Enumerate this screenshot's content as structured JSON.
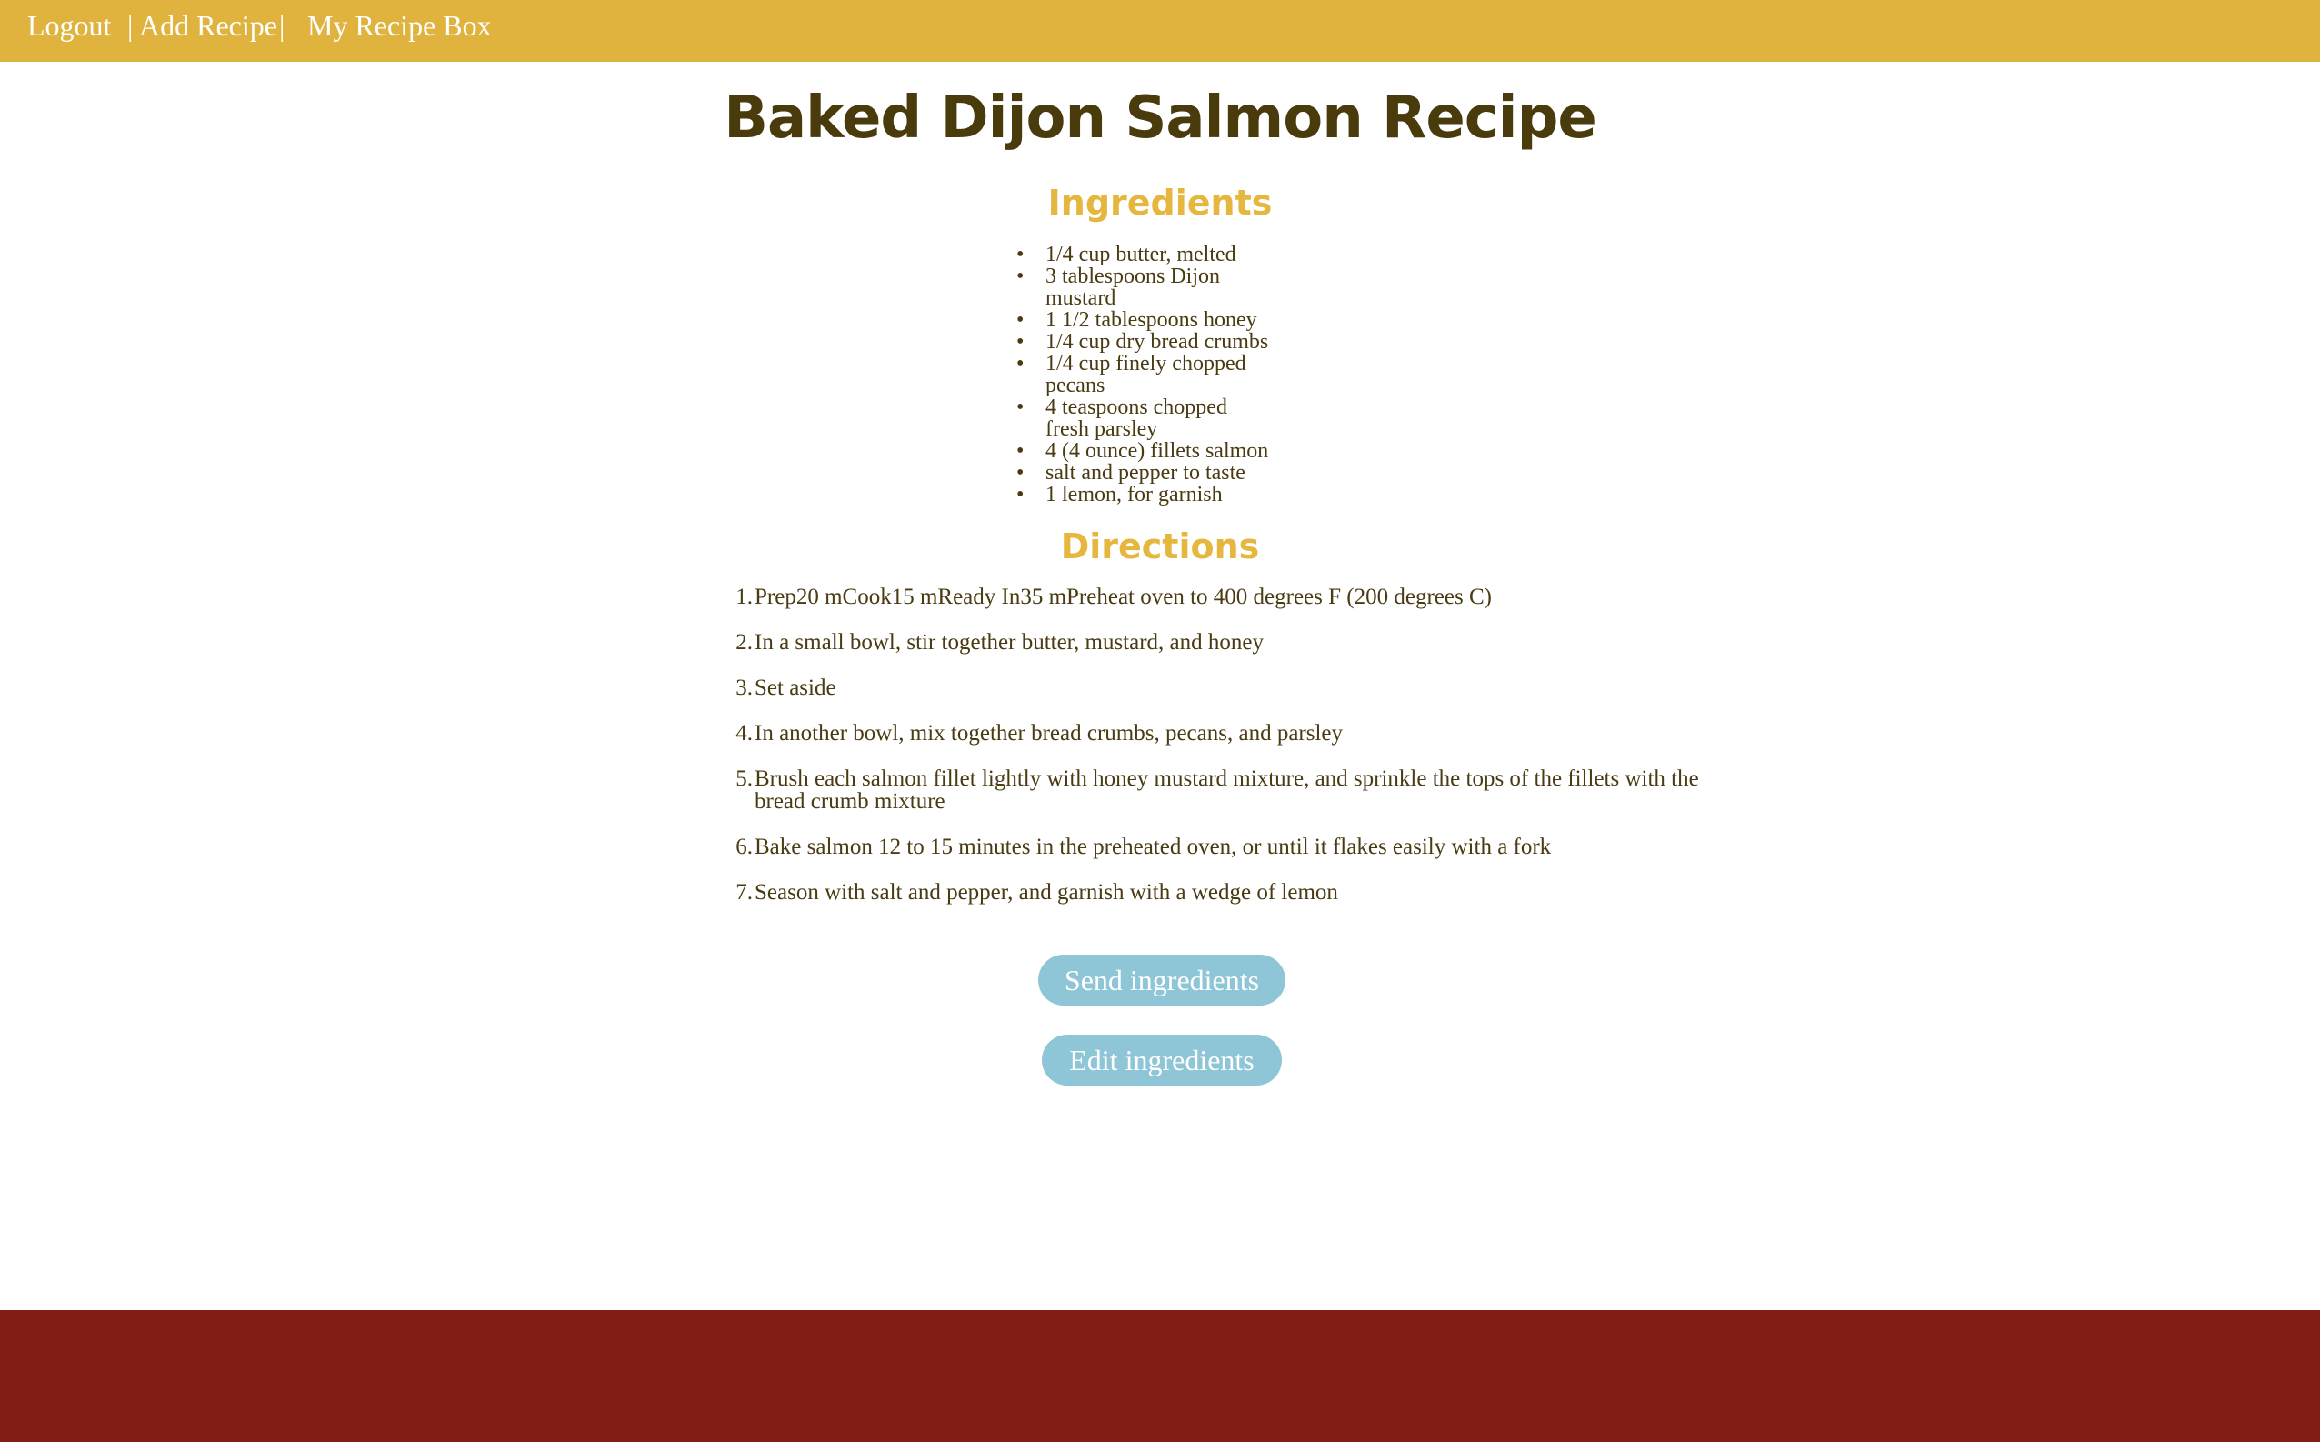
{
  "nav": {
    "logout": "Logout",
    "separator_left": "|",
    "add_recipe": "Add Recipe",
    "separator_right": "|",
    "my_recipe_box": "My Recipe Box"
  },
  "title": "Baked Dijon Salmon Recipe",
  "ingredients": {
    "heading": "Ingredients",
    "items": [
      [
        "1/4 cup butter, melted"
      ],
      [
        "3 tablespoons Dijon",
        "mustard"
      ],
      [
        "1 1/2 tablespoons honey"
      ],
      [
        "1/4 cup dry bread crumbs"
      ],
      [
        "1/4 cup finely chopped",
        "pecans"
      ],
      [
        "4 teaspoons chopped",
        "fresh parsley"
      ],
      [
        "4 (4 ounce) fillets salmon"
      ],
      [
        "salt and pepper to taste"
      ],
      [
        "1 lemon, for garnish"
      ]
    ]
  },
  "directions": {
    "heading": "Directions",
    "steps": [
      [
        "Prep20 mCook15 mReady In35 mPreheat oven to 400 degrees F (200 degrees C)"
      ],
      [
        "In a small bowl, stir together butter, mustard, and honey"
      ],
      [
        "Set aside"
      ],
      [
        "In another bowl, mix together bread crumbs, pecans, and parsley"
      ],
      [
        "Brush each salmon fillet lightly with honey mustard mixture, and sprinkle the tops of the fillets with the",
        "bread crumb mixture"
      ],
      [
        "Bake salmon 12 to 15 minutes in the preheated oven, or until it flakes easily with a fork"
      ],
      [
        "Season with salt and pepper, and garnish with a wedge of lemon"
      ]
    ]
  },
  "buttons": {
    "send": "Send ingredients",
    "edit": "Edit ingredients"
  },
  "colors": {
    "navbar": "#dfb33e",
    "heading_accent": "#e6b73f",
    "button": "#8ec5d7",
    "footer": "#811c16",
    "text": "#4a3b12"
  }
}
